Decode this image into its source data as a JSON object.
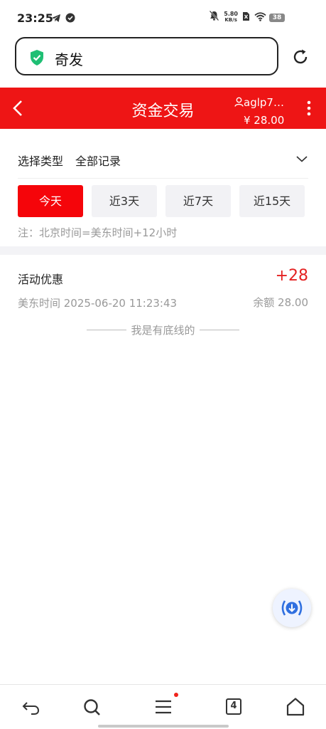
{
  "status_bar": {
    "time": "23:25",
    "net_speed_value": "5.80",
    "net_speed_unit": "KB/s",
    "battery": "38"
  },
  "address_bar": {
    "text": "奇发"
  },
  "header": {
    "title": "资金交易",
    "username": "aglp7…",
    "balance": "¥ 28.00"
  },
  "filter": {
    "label": "选择类型",
    "value": "全部记录"
  },
  "day_tabs": [
    {
      "label": "今天",
      "active": true
    },
    {
      "label": "近3天",
      "active": false
    },
    {
      "label": "近7天",
      "active": false
    },
    {
      "label": "近15天",
      "active": false
    }
  ],
  "note": "注：北京时间=美东时间+12小时",
  "records": [
    {
      "type": "活动优惠",
      "amount": "+28",
      "time": "美东时间 2025-06-20 11:23:43",
      "balance": "余额 28.00"
    }
  ],
  "bottom_line": "我是有底线的",
  "bottom_nav": {
    "tab_count": "4"
  },
  "colors": {
    "brand_red": "#ee1515",
    "active_tab": "#f5050a",
    "amount_red": "#e42121",
    "shield_green": "#1fbf74"
  },
  "icons": [
    "telegram-icon",
    "check-circle-icon",
    "mute-bell-icon",
    "sim-icon",
    "wifi-icon",
    "shield-check-icon",
    "refresh-icon",
    "back-arrow-icon",
    "user-icon",
    "more-vert-icon",
    "chevron-down-icon",
    "download-icon",
    "undo-icon",
    "search-icon",
    "menu-icon",
    "tabs-icon",
    "home-icon"
  ]
}
